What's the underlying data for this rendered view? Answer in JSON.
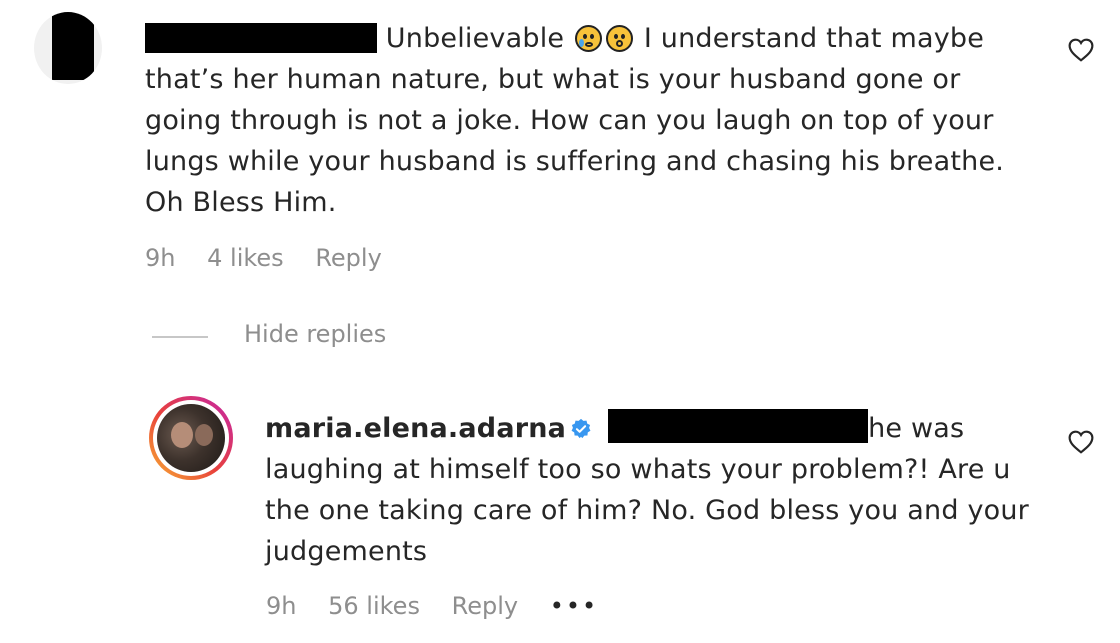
{
  "comment": {
    "text_before_emoji": "Unbelievable",
    "emoji": [
      "crying-face",
      "astonished-face"
    ],
    "text_after_emoji": "I understand that maybe that’s her human nature, but what is your husband gone or going through is not a joke. How can you laugh on top of your lungs while your husband is suffering and chasing his breathe. Oh Bless Him.",
    "time": "9h",
    "likes": "4 likes",
    "reply_label": "Reply",
    "like_icon": "heart-outline-icon"
  },
  "thread": {
    "hide_replies_label": "Hide replies"
  },
  "reply": {
    "username": "maria.elena.adarna",
    "verified_icon": "verified-badge-icon",
    "text": "he was laughing at himself too so whats your problem?! Are u the one taking care of him? No. God bless you and your judgements",
    "time": "9h",
    "likes": "56 likes",
    "reply_label": "Reply",
    "more_label": "•••",
    "like_icon": "heart-outline-icon"
  },
  "colors": {
    "text": "#262626",
    "meta": "#8e8e8e",
    "verified": "#3897f0",
    "story_ring_start": "#f9b233",
    "story_ring_end": "#c425a9"
  }
}
